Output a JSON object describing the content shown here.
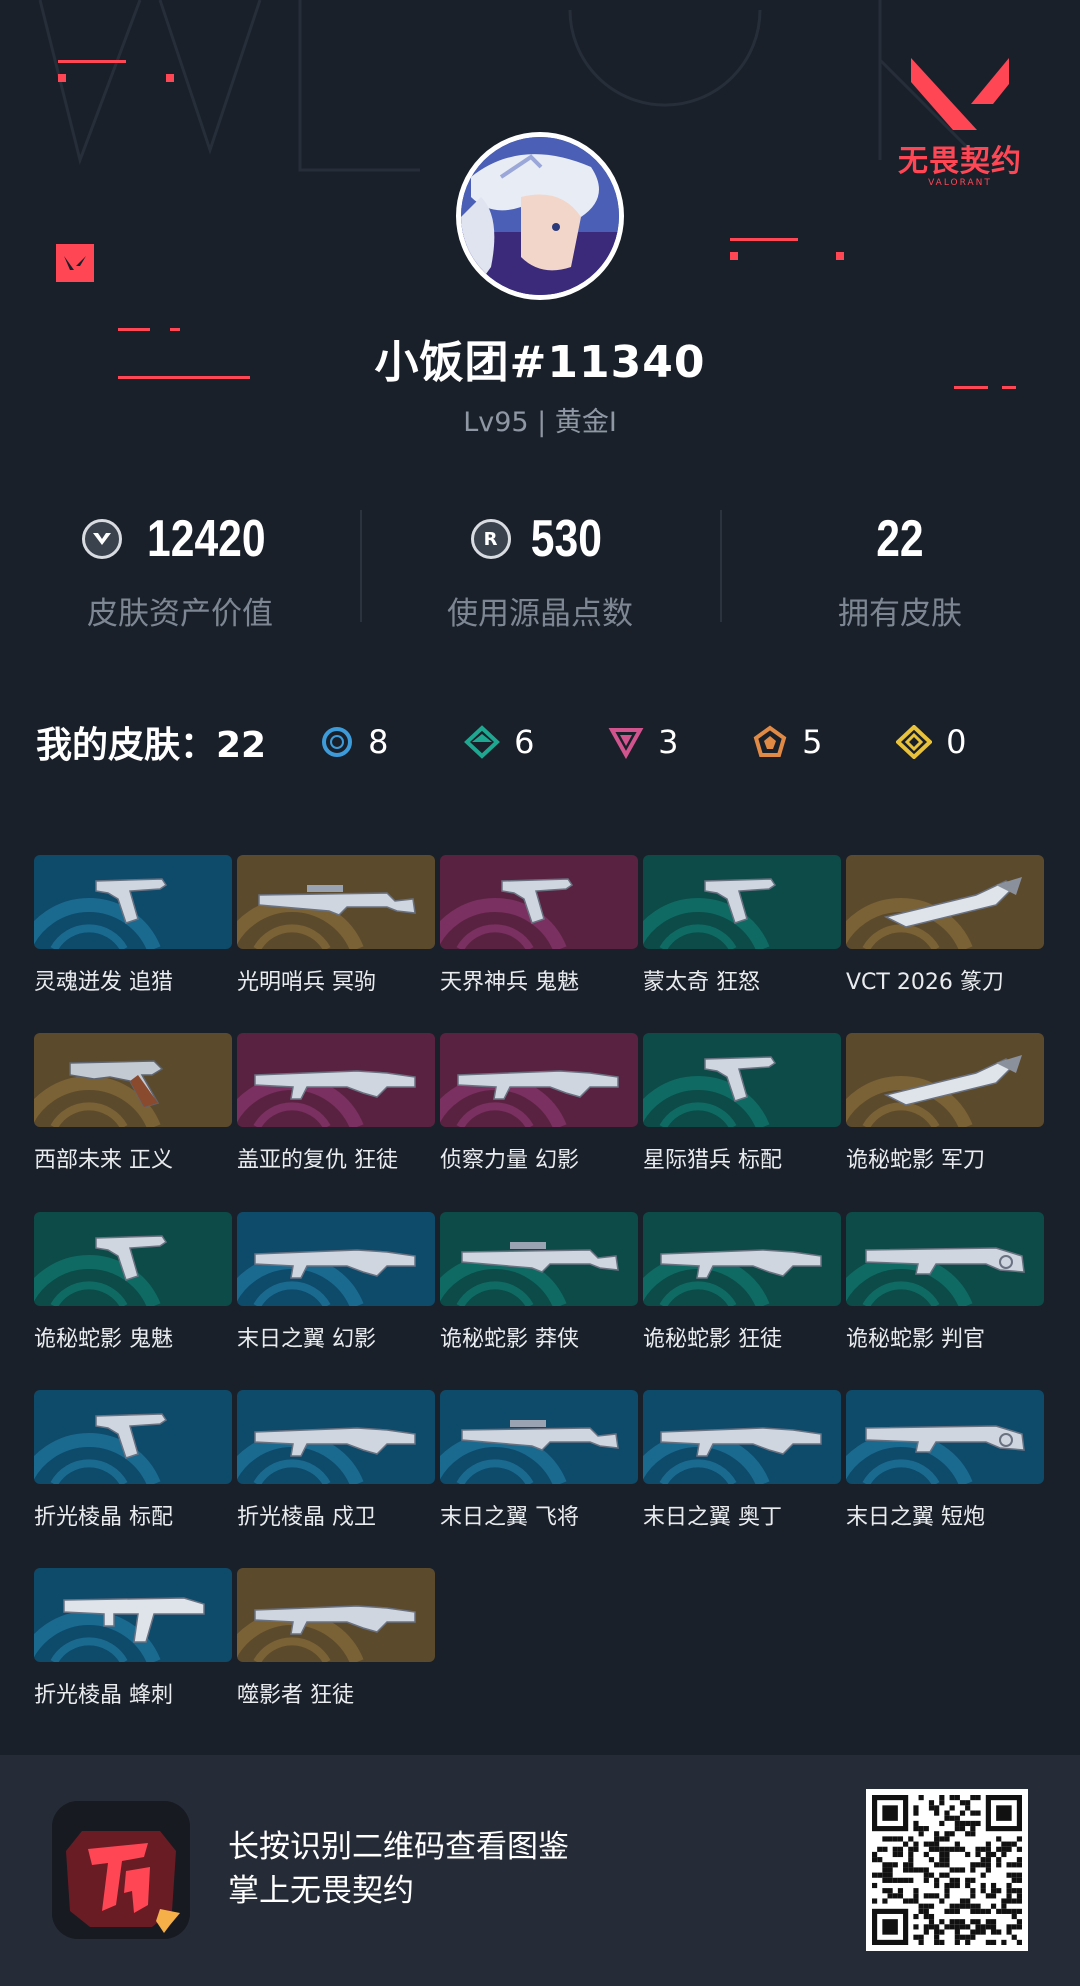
{
  "brand": {
    "name": "无畏契约",
    "sub": "VALORANT"
  },
  "profile": {
    "username": "小饭团#11340",
    "level": "Lv95 | 黄金I"
  },
  "stats": [
    {
      "icon": "vp-icon",
      "value": "12420",
      "label": "皮肤资产价值"
    },
    {
      "icon": "radianite-icon",
      "value": "530",
      "label": "使用源晶点数"
    },
    {
      "icon": "",
      "value": "22",
      "label": "拥有皮肤"
    }
  ],
  "skins_summary": {
    "title": "我的皮肤：22",
    "tiers": [
      {
        "name": "select-tier-icon",
        "color": "#3d9bd9",
        "count": "8"
      },
      {
        "name": "deluxe-tier-icon",
        "color": "#1ea891",
        "count": "6"
      },
      {
        "name": "premium-tier-icon",
        "color": "#d1548f",
        "count": "3"
      },
      {
        "name": "exclusive-tier-icon",
        "color": "#e08a45",
        "count": "5"
      },
      {
        "name": "ultra-tier-icon",
        "color": "#e8c23a",
        "count": "0"
      }
    ]
  },
  "skins": [
    {
      "name": "灵魂迸发 追猎",
      "tier": "blue",
      "gun": "pistol"
    },
    {
      "name": "光明哨兵 冥驹",
      "tier": "gold",
      "gun": "sniper"
    },
    {
      "name": "天界神兵 鬼魅",
      "tier": "pink",
      "gun": "pistol"
    },
    {
      "name": "蒙太奇 狂怒",
      "tier": "green",
      "gun": "pistol"
    },
    {
      "name": "VCT 2026 篆刀",
      "tier": "gold",
      "gun": "knife"
    },
    {
      "name": "西部未来 正义",
      "tier": "gold",
      "gun": "revolver"
    },
    {
      "name": "盖亚的复仇 狂徒",
      "tier": "pink",
      "gun": "rifle"
    },
    {
      "name": "侦察力量 幻影",
      "tier": "pink",
      "gun": "rifle"
    },
    {
      "name": "星际猎兵 标配",
      "tier": "green",
      "gun": "pistol"
    },
    {
      "name": "诡秘蛇影 军刀",
      "tier": "gold",
      "gun": "knife"
    },
    {
      "name": "诡秘蛇影 鬼魅",
      "tier": "green",
      "gun": "pistol"
    },
    {
      "name": "末日之翼 幻影",
      "tier": "blue",
      "gun": "rifle"
    },
    {
      "name": "诡秘蛇影 莽侠",
      "tier": "green",
      "gun": "sniper"
    },
    {
      "name": "诡秘蛇影 狂徒",
      "tier": "green",
      "gun": "rifle"
    },
    {
      "name": "诡秘蛇影 判官",
      "tier": "green",
      "gun": "shotgun"
    },
    {
      "name": "折光棱晶 标配",
      "tier": "blue",
      "gun": "pistol"
    },
    {
      "name": "折光棱晶 戍卫",
      "tier": "blue",
      "gun": "rifle"
    },
    {
      "name": "末日之翼 飞将",
      "tier": "blue",
      "gun": "sniper"
    },
    {
      "name": "末日之翼 奥丁",
      "tier": "blue",
      "gun": "rifle"
    },
    {
      "name": "末日之翼 短炮",
      "tier": "blue",
      "gun": "shotgun"
    },
    {
      "name": "折光棱晶 蜂刺",
      "tier": "blue",
      "gun": "smg"
    },
    {
      "name": "噬影者 狂徒",
      "tier": "gold",
      "gun": "rifle"
    }
  ],
  "footer": {
    "line1": "长按识别二维码查看图鉴",
    "line2": "掌上无畏契约"
  },
  "colors": {
    "accent": "#ff4655",
    "background": "#1a2029",
    "footer": "#252c37"
  }
}
